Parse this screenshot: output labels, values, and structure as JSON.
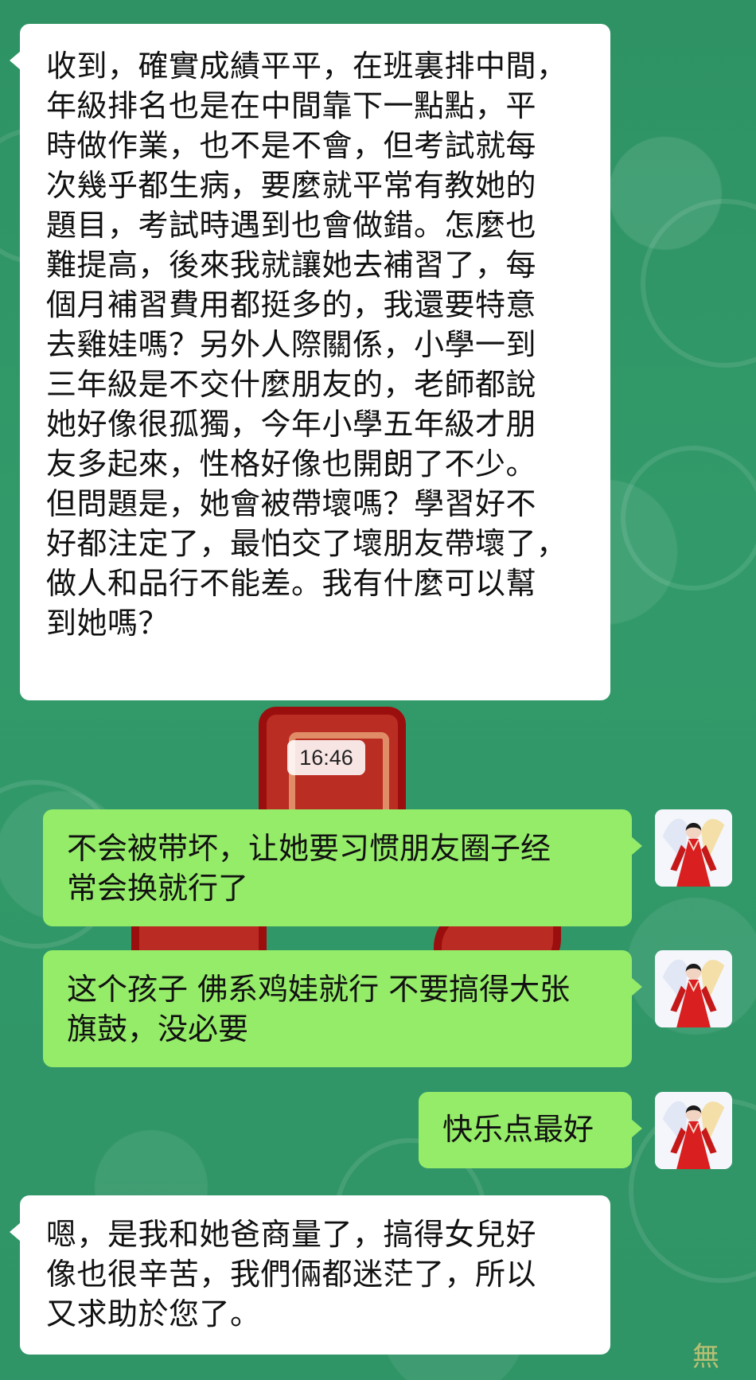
{
  "chat": {
    "messages": [
      {
        "side": "incoming",
        "text": "收到，確實成績平平，在班裏排中間，\n年級排名也是在中間靠下一點點，平\n時做作業，也不是不會，但考試就每\n次幾乎都生病，要麼就平常有教她的\n題目，考試時遇到也會做錯。怎麼也\n難提高，後來我就讓她去補習了，每\n個月補習費用都挺多的，我還要特意\n去雞娃嗎？另外人際關係，小學一到\n三年級是不交什麼朋友的，老師都說\n她好像很孤獨，今年小學五年級才朋\n友多起來，性格好像也開朗了不少。\n但問題是，她會被帶壞嗎？學習好不\n好都注定了，最怕交了壞朋友帶壞了，\n做人和品行不能差。我有什麼可以幫\n到她嗎？"
      },
      {
        "side": "outgoing",
        "text": "不会被带坏，让她要习惯朋友圈子经\n常会换就行了"
      },
      {
        "side": "outgoing",
        "text": "这个孩子 佛系鸡娃就行 不要搞得大张\n旗鼓，没必要"
      },
      {
        "side": "outgoing",
        "text": "快乐点最好"
      },
      {
        "side": "incoming",
        "text": "嗯，是我和她爸商量了，搞得女兒好\n像也很辛苦，我們倆都迷茫了，所以\n又求助於您了。"
      }
    ],
    "timestamp": "16:46",
    "background_glyph": "無"
  },
  "colors": {
    "background": "#2f9466",
    "incoming_bubble": "#ffffff",
    "outgoing_bubble": "#95ec69",
    "text": "#111111",
    "timestamp_bg": "#ffffff",
    "motif_red": "#c81e19"
  },
  "icons": {
    "avatar": "avatar-woman-red-hanfu-icon"
  }
}
